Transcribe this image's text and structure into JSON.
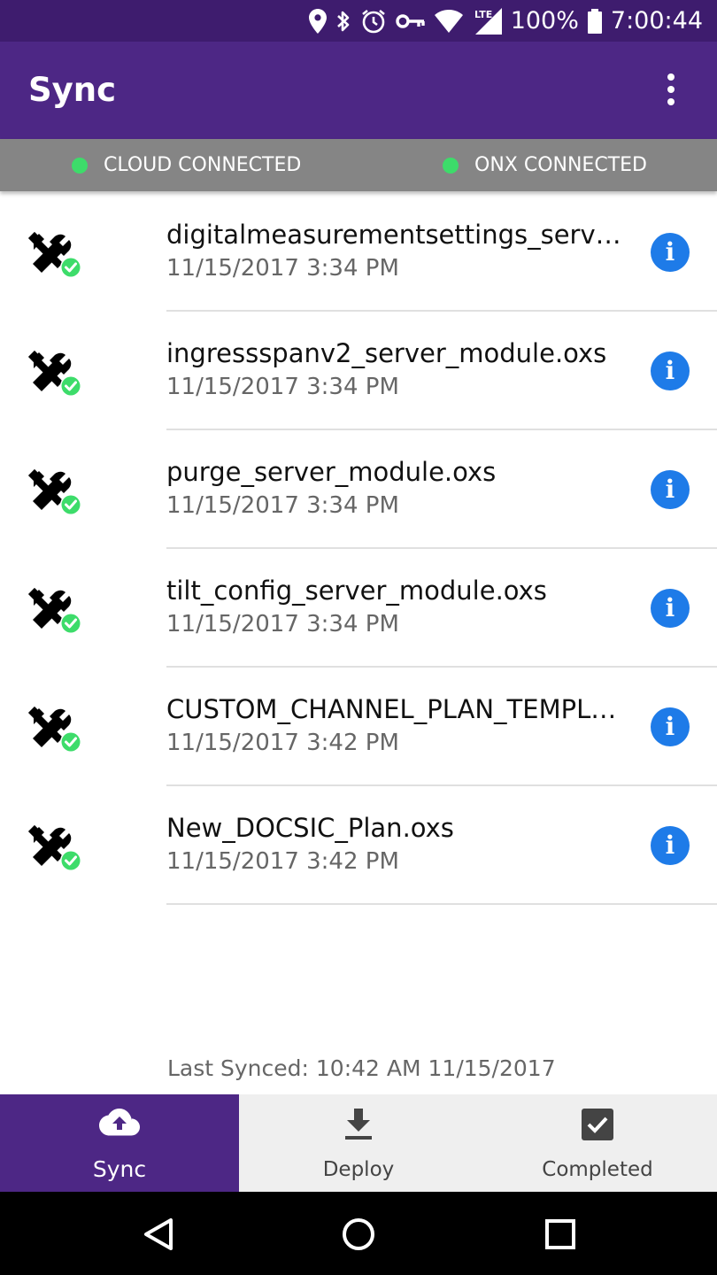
{
  "status_bar": {
    "battery": "100%",
    "time": "7:00:44",
    "icons": [
      "location-icon",
      "bluetooth-icon",
      "alarm-icon",
      "key-icon",
      "wifi-icon",
      "lte-signal-icon",
      "battery-icon"
    ],
    "network_label": "LTE"
  },
  "app_bar": {
    "title": "Sync",
    "menu_icon": "overflow-menu-icon"
  },
  "connection": {
    "cloud": "CLOUD CONNECTED",
    "onx": "ONX CONNECTED",
    "indicator_color": "#3ddc6a"
  },
  "files": [
    {
      "name": "digitalmeasurementsettings_server_…",
      "date": "11/15/2017 3:34 PM"
    },
    {
      "name": "ingressspanv2_server_module.oxs",
      "date": "11/15/2017 3:34 PM"
    },
    {
      "name": "purge_server_module.oxs",
      "date": "11/15/2017 3:34 PM"
    },
    {
      "name": "tilt_config_server_module.oxs",
      "date": "11/15/2017 3:34 PM"
    },
    {
      "name": "CUSTOM_CHANNEL_PLAN_TEMPL…",
      "date": "11/15/2017 3:42 PM"
    },
    {
      "name": "New_DOCSIC_Plan.oxs",
      "date": "11/15/2017 3:42 PM"
    }
  ],
  "info_glyph": "i",
  "last_synced": "Last Synced: 10:42 AM 11/15/2017",
  "bottom_nav": {
    "sync": "Sync",
    "deploy": "Deploy",
    "completed": "Completed"
  },
  "colors": {
    "status_bar": "#3e1c6e",
    "app_bar": "#4d2785",
    "connection_bar": "#858585",
    "info_button": "#1e7be8",
    "check_badge": "#3ddc6a"
  }
}
